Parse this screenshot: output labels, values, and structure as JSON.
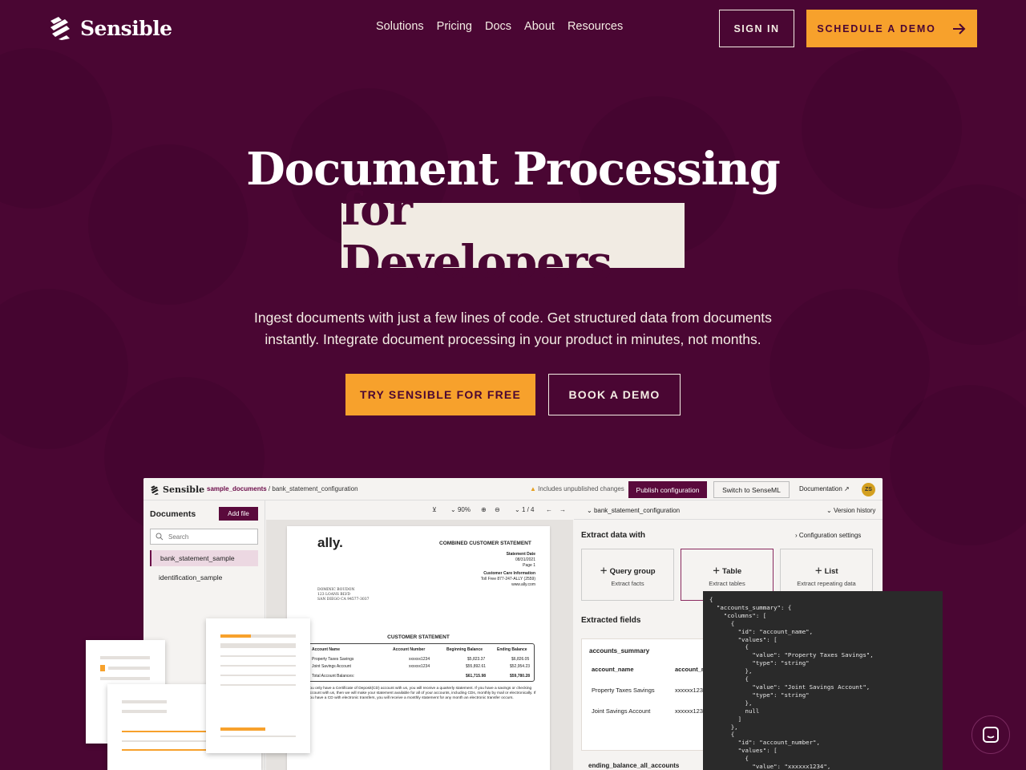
{
  "brand": {
    "name": "Sensible"
  },
  "nav": {
    "links": [
      "Solutions",
      "Pricing",
      "Docs",
      "About",
      "Resources"
    ],
    "sign_in": "SIGN IN",
    "schedule_demo": "SCHEDULE A DEMO"
  },
  "hero": {
    "title_line1": "Document Processing",
    "title_line2": "for Developers",
    "subtitle_line1": "Ingest documents with just a few lines of code. Get structured data from documents",
    "subtitle_line2": "instantly. Integrate document processing in your product in minutes, not months.",
    "cta_primary": "TRY SENSIBLE FOR FREE",
    "cta_secondary": "BOOK A DEMO"
  },
  "colors": {
    "background": "#4a0633",
    "accent": "#f7a12c",
    "highlight": "#f1ebe3"
  },
  "app": {
    "logo": "Sensible",
    "breadcrumb_folder": "sample_documents",
    "breadcrumb_sep": " / ",
    "breadcrumb_file": "bank_statement_configuration",
    "warning": "Includes unpublished changes",
    "publish": "Publish configuration",
    "switch": "Switch to SenseML",
    "documentation": "Documentation",
    "avatar": "ZS",
    "sidebar": {
      "title": "Documents",
      "add_file": "Add file",
      "search_placeholder": "Search",
      "items": [
        "bank_statement_sample",
        "identification_sample"
      ]
    },
    "viewer": {
      "zoom": "90%",
      "page": "1 / 4",
      "doc": {
        "logo": "ally.",
        "header": "COMBINED CUSTOMER STATEMENT",
        "stmt_date_label": "Statement Date",
        "stmt_date": "08/31/2021",
        "page": "Page 1",
        "care_label": "Customer Care Information",
        "care_phone": "Toll Free 877-247-ALLY (2559)",
        "care_web": "www.ally.com",
        "addr1": "DOMINIC BOUDON",
        "addr2": "123 LOANS BLVD",
        "addr3": "SAN DIEGO CA  94577-3037",
        "section": "CUSTOMER STATEMENT",
        "col_name": "Account Name",
        "col_number": "Account Number",
        "col_begin": "Beginning Balance",
        "col_end": "Ending Balance",
        "row1": [
          "Property Taxes Savings",
          "xxxxxx1234",
          "$5,823.37",
          "$6,826.05"
        ],
        "row2": [
          "Joint Savings Account",
          "xxxxxx1234",
          "$55,892.61",
          "$52,954.23"
        ],
        "total": [
          "Total Account Balances:",
          "$61,715.98",
          "$59,780.28"
        ],
        "para": "you only have a Certificate of Deposit(CD) account with us, you will receive a quarterly statement.  If you have a savings or checking account with us, then we will make your statement available for all of your accounts, including CDs, monthly by mail or electronically.  If you have a CD with electronic transfers, you will receive a monthly statement for any month an electronic transfer occurs."
      }
    },
    "right": {
      "config_name": "bank_statement_configuration",
      "version_history": "Version history",
      "extract_with": "Extract data with",
      "config_settings": "Configuration settings",
      "cards": [
        {
          "title": "Query group",
          "sub": "Extract facts"
        },
        {
          "title": "Table",
          "sub": "Extract tables"
        },
        {
          "title": "List",
          "sub": "Extract repeating data"
        }
      ],
      "extracted_fields": "Extracted fields",
      "field_group": "accounts_summary",
      "field_col1": "account_name",
      "field_col2": "account_nu",
      "field_rows": [
        [
          "Property Taxes Savings",
          "xxxxxx1234"
        ],
        [
          "Joint Savings Account",
          "xxxxxx1234"
        ]
      ],
      "field_group2": "ending_balance_all_accounts"
    },
    "code": "{\n  \"accounts_summary\": {\n    \"columns\": [\n      {\n        \"id\": \"account_name\",\n        \"values\": [\n          {\n            \"value\": \"Property Taxes Savings\",\n            \"type\": \"string\"\n          },\n          {\n            \"value\": \"Joint Savings Account\",\n            \"type\": \"string\"\n          },\n          null\n        ]\n      },\n      {\n        \"id\": \"account_number\",\n        \"values\": [\n          {\n            \"value\": \"xxxxxx1234\","
  }
}
